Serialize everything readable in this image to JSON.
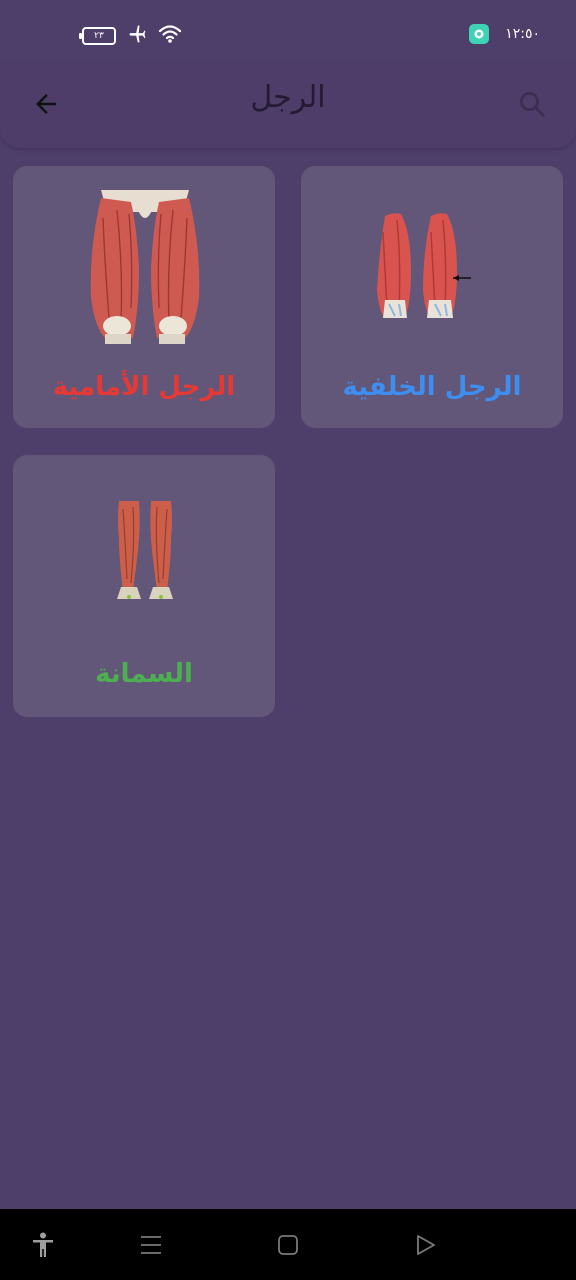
{
  "status_bar": {
    "time": "١٢:٥٠",
    "battery_level": "٢٣",
    "icons": [
      "battery-icon",
      "airplane-icon",
      "wifi-icon",
      "app-notification-icon"
    ]
  },
  "app_bar": {
    "title": "الرجل",
    "back_icon": "arrow-back-icon",
    "search_icon": "search-icon"
  },
  "cards": [
    {
      "label": "الرجل الخلفية",
      "image": "hamstring-muscles-image",
      "color": "#3d8ef0"
    },
    {
      "label": "الرجل الأمامية",
      "image": "quadriceps-muscles-image",
      "color": "#e53935"
    },
    {
      "label": "السمانة",
      "image": "calf-muscles-image",
      "color": "#4caf50"
    }
  ],
  "nav_bar": {
    "icons": [
      "accessibility-icon",
      "menu-icon",
      "home-icon",
      "back-icon"
    ]
  },
  "colors": {
    "background": "#4e3e6a",
    "card": "#625679",
    "title": "#241a34"
  }
}
